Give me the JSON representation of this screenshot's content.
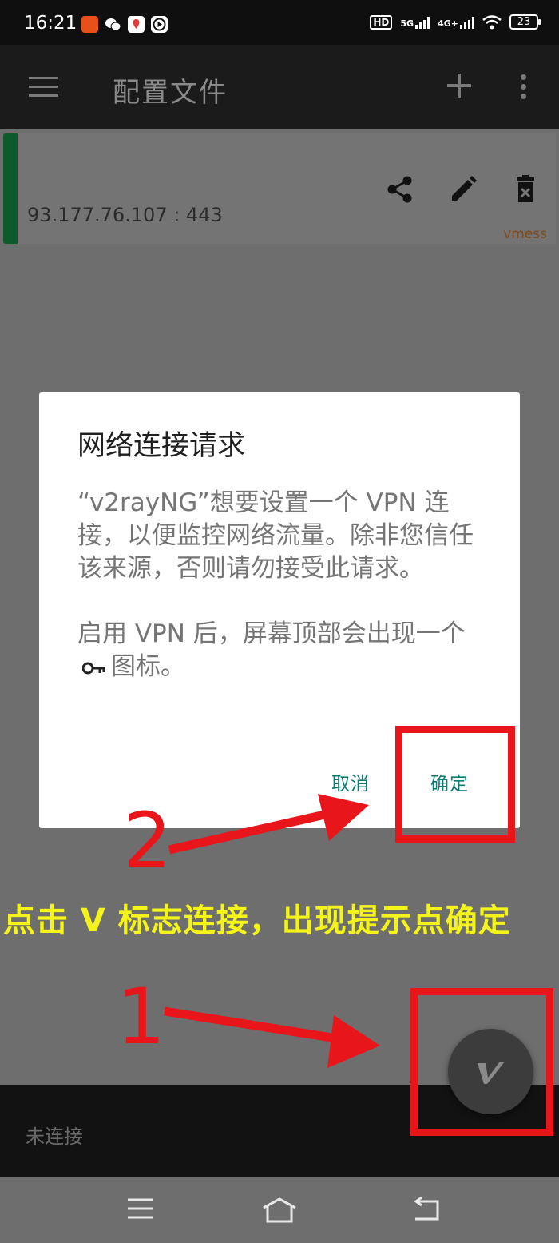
{
  "status_bar": {
    "time": "16:21",
    "battery": "23",
    "hd_label": "HD",
    "network_5g": "5G",
    "network_4g": "4G+",
    "icons": [
      "app-notify-icon",
      "wechat-icon",
      "maps-icon",
      "play-icon",
      "signal-icon",
      "wifi-icon",
      "battery-icon"
    ]
  },
  "app_bar": {
    "title": "配置文件",
    "icons": [
      "menu-icon",
      "add-icon",
      "more-icon"
    ]
  },
  "server_card": {
    "address": "93.177.76.107 : 443",
    "type": "vmess",
    "actions": [
      "share-icon",
      "edit-icon",
      "delete-icon"
    ]
  },
  "dialog": {
    "title": "网络连接请求",
    "body_line1": "“v2rayNG”想要设置一个 VPN 连接，以便监控网络流量。除非您信任该来源，否则请勿接受此请求。",
    "body_line2_before": "启用 VPN 后，屏幕顶部会出现一个",
    "body_line2_after": "图标。",
    "key_icon": "key-icon",
    "cancel_label": "取消",
    "ok_label": "确定"
  },
  "connection": {
    "status": "未连接"
  },
  "annotations": {
    "step1": "1",
    "step2": "2",
    "caption": "点击 V 标志连接，出现提示点确定"
  },
  "colors": {
    "accent": "#0e7d72",
    "annotation_red": "#e8151b",
    "caption_yellow": "#f4f41a",
    "card_stripe": "#0d5a2a",
    "vmess_label": "#7c4a1a"
  }
}
